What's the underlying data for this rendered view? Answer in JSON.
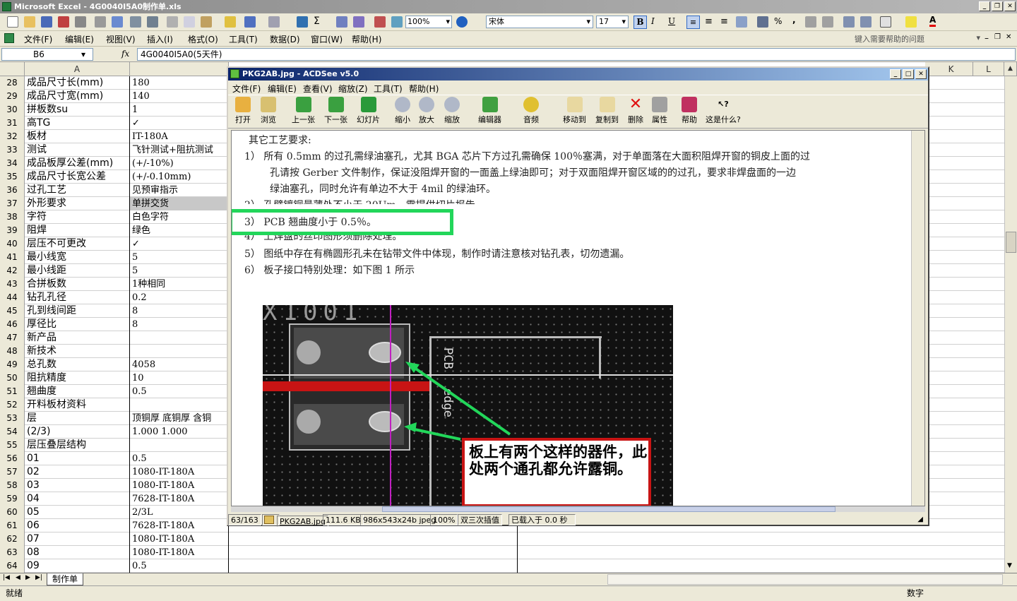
{
  "excel": {
    "title": "Microsoft Excel - 4G0040I5A0制作单.xls",
    "font_name": "宋体",
    "font_size": "17",
    "zoom": "100%",
    "menu": [
      "文件(F)",
      "编辑(E)",
      "视图(V)",
      "插入(I)",
      "格式(O)",
      "工具(T)",
      "数据(D)",
      "窗口(W)",
      "帮助(H)"
    ],
    "help_placeholder": "键入需要帮助的问题",
    "name_box": "B6",
    "fx": "fx",
    "formula": "4G0040I5A0(5天件)",
    "col_a": "A",
    "col_k": "K",
    "col_l": "L",
    "rows": [
      {
        "n": "28",
        "a": "成品尺寸长(mm)",
        "b": "180"
      },
      {
        "n": "29",
        "a": "成品尺寸宽(mm)",
        "b": "140"
      },
      {
        "n": "30",
        "a": "拼板数su",
        "b": "1"
      },
      {
        "n": "31",
        "a": "高TG",
        "b": "✓"
      },
      {
        "n": "32",
        "a": "板材",
        "b": "IT-180A"
      },
      {
        "n": "33",
        "a": "测试",
        "b": "飞针测试+阻抗测试"
      },
      {
        "n": "34",
        "a": "成品板厚公差(mm)",
        "b": "(+/-10%)"
      },
      {
        "n": "35",
        "a": "成品尺寸长宽公差",
        "b": "(+/-0.10mm)"
      },
      {
        "n": "36",
        "a": "过孔工艺",
        "b": "见预审指示"
      },
      {
        "n": "37",
        "a": "外形要求",
        "b": "单拼交货"
      },
      {
        "n": "38",
        "a": "字符",
        "b": "白色字符"
      },
      {
        "n": "39",
        "a": "阻焊",
        "b": "绿色"
      },
      {
        "n": "40",
        "a": "层压不可更改",
        "b": "✓"
      },
      {
        "n": "41",
        "a": "最小线宽",
        "b": "5"
      },
      {
        "n": "42",
        "a": "最小线距",
        "b": "5"
      },
      {
        "n": "43",
        "a": "合拼板数",
        "b": "1种相同"
      },
      {
        "n": "44",
        "a": "钻孔孔径",
        "b": "0.2"
      },
      {
        "n": "45",
        "a": "孔到线间距",
        "b": "8"
      },
      {
        "n": "46",
        "a": "厚径比",
        "b": "8"
      },
      {
        "n": "47",
        "a": "新产品",
        "b": ""
      },
      {
        "n": "48",
        "a": "新技术",
        "b": ""
      },
      {
        "n": "49",
        "a": "总孔数",
        "b": "4058"
      },
      {
        "n": "50",
        "a": "阻抗精度",
        "b": "10"
      },
      {
        "n": "51",
        "a": "翘曲度",
        "b": "0.5"
      },
      {
        "n": "52",
        "a": "开料板材资料",
        "b": ""
      },
      {
        "n": "53",
        "a": "层",
        "b": "顶铜厚 底铜厚 含铜"
      },
      {
        "n": "54",
        "a": "(2/3)",
        "b": "1.000  1.000"
      },
      {
        "n": "55",
        "a": "层压叠层结构",
        "b": ""
      },
      {
        "n": "56",
        "a": "01",
        "b": "0.5"
      },
      {
        "n": "57",
        "a": "02",
        "b": "1080-IT-180A"
      },
      {
        "n": "58",
        "a": "03",
        "b": "1080-IT-180A"
      },
      {
        "n": "59",
        "a": "04",
        "b": "7628-IT-180A"
      },
      {
        "n": "60",
        "a": "05",
        "b": "2/3L"
      },
      {
        "n": "61",
        "a": "06",
        "b": "7628-IT-180A"
      },
      {
        "n": "62",
        "a": "07",
        "b": "1080-IT-180A"
      },
      {
        "n": "63",
        "a": "08",
        "b": "1080-IT-180A"
      },
      {
        "n": "64",
        "a": "09",
        "b": "0.5"
      }
    ],
    "sheet_tab": "制作单",
    "status_left": "就绪",
    "status_right": "数字"
  },
  "acdsee": {
    "title": "PKG2AB.jpg - ACDSee v5.0",
    "menu": [
      "文件(F)",
      "编辑(E)",
      "查看(V)",
      "缩放(Z)",
      "工具(T)",
      "帮助(H)"
    ],
    "tools": [
      "打开",
      "浏览",
      "上一张",
      "下一张",
      "幻灯片",
      "缩小",
      "放大",
      "缩放",
      "编辑器",
      "音频",
      "移动到",
      "复制到",
      "删除",
      "属性",
      "帮助",
      "这是什么?"
    ],
    "status": [
      "63/163",
      "PKG2AB.jpg",
      "111.6 KB",
      "986x543x24b jpeg",
      "100%",
      "双三次插值",
      "已载入于 0.0 秒"
    ]
  },
  "document": {
    "heading": "其它工艺要求:",
    "line1": "1）  所有 0.5mm 的过孔需绿油塞孔，尤其 BGA 芯片下方过孔需确保 100％塞满，对于单面落在大面积阻焊开窗的铜皮上面的过",
    "line1b": "孔请按 Gerber 文件制作，保证没阻焊开窗的一面盖上绿油即可；对于双面阻焊开窗区域的的过孔，要求非焊盘面的一边",
    "line1c": "绿油塞孔，同时允许有单边不大于 4mil 的绿油环。",
    "line2": "2）  孔壁镀铜最薄处不小于 20Um，需提供切片报告。",
    "line3": "3）  PCB 翘曲度小于 0.5％。",
    "line4": "4）  上焊盘的丝印图形须删除处理。",
    "line5": "5）  图纸中存在有椭圆形孔未在钻带文件中体现，制作时请注意核对钻孔表，切勿遗漏。",
    "line6": "6）  板子接口特别处理：如下图 1 所示",
    "pcb_label1": "PCB",
    "pcb_label2": "edge",
    "silk_text": "X1001",
    "callout": "板上有两个这样的器件，此处两个通孔都允许露铜。"
  }
}
